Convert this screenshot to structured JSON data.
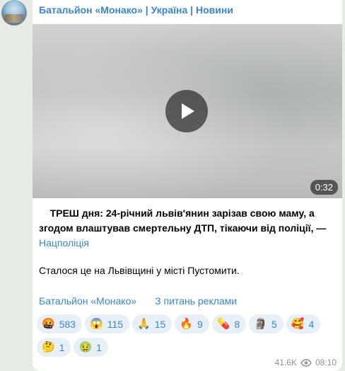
{
  "channel": {
    "title": "Батальйон «Монако» | Україна | Новини"
  },
  "video": {
    "duration": "0:32"
  },
  "post": {
    "headline_bold": "ТРЕШ дня",
    "headline_rest": ": 24-річний львів'янин зарізав свою маму, а згодом влаштував смертельну ДТП, тікаючи від поліції, — ",
    "source_link": "Нацполіція",
    "paragraph2": "Сталося це на Львівщині у місті Пустомити.",
    "channel_link": "Батальйон «Монако»",
    "ads_link": "З питань реклами"
  },
  "reactions": [
    {
      "emoji": "🤬",
      "count": "583"
    },
    {
      "emoji": "😱",
      "count": "115"
    },
    {
      "emoji": "🙏",
      "count": "15"
    },
    {
      "emoji": "🔥",
      "count": "9"
    },
    {
      "emoji": "💊",
      "count": "8"
    },
    {
      "emoji": "🗿",
      "count": "5"
    },
    {
      "emoji": "🥰",
      "count": "4"
    },
    {
      "emoji": "🤔",
      "count": "1"
    },
    {
      "emoji": "🤢",
      "count": "1"
    }
  ],
  "meta": {
    "views": "41.6K",
    "time": "08:10"
  }
}
